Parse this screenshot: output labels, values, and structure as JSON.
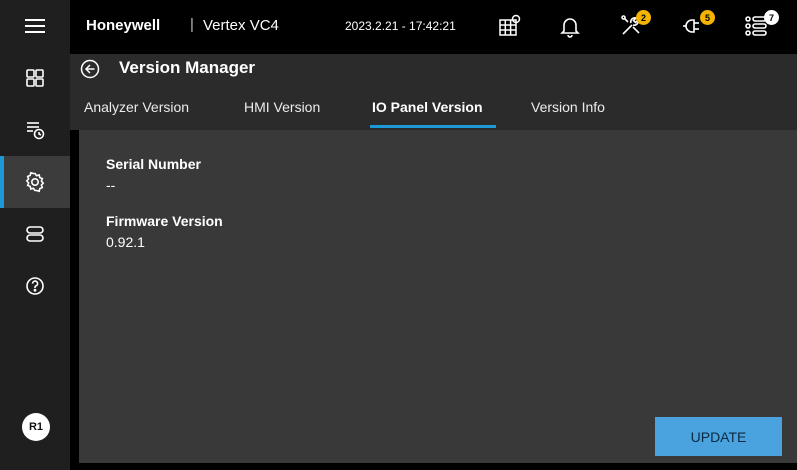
{
  "topbar": {
    "brand": "Honeywell",
    "separator": "|",
    "product": "Vertex VC4",
    "datetime": "2023.2.21 - 17:42:21",
    "badges": {
      "maintenance": "2",
      "faults": "5",
      "list": "7"
    }
  },
  "sidebar": {
    "items": [
      {
        "icon": "grid-icon"
      },
      {
        "icon": "list-clock-icon"
      },
      {
        "icon": "gear-icon",
        "active": true
      },
      {
        "icon": "stack-icon"
      },
      {
        "icon": "help-icon"
      }
    ],
    "user_initials": "R1"
  },
  "header": {
    "title": "Version Manager",
    "tabs": [
      {
        "label": "Analyzer Version"
      },
      {
        "label": "HMI Version"
      },
      {
        "label": "IO Panel Version",
        "active": true
      },
      {
        "label": "Version Info"
      }
    ]
  },
  "main": {
    "fields": [
      {
        "label": "Serial Number",
        "value": "--"
      },
      {
        "label": "Firmware Version",
        "value": "0.92.1"
      }
    ],
    "update_label": "UPDATE"
  },
  "colors": {
    "accent": "#1d9ad6",
    "badge": "#f4b400",
    "button": "#4aa3df"
  }
}
